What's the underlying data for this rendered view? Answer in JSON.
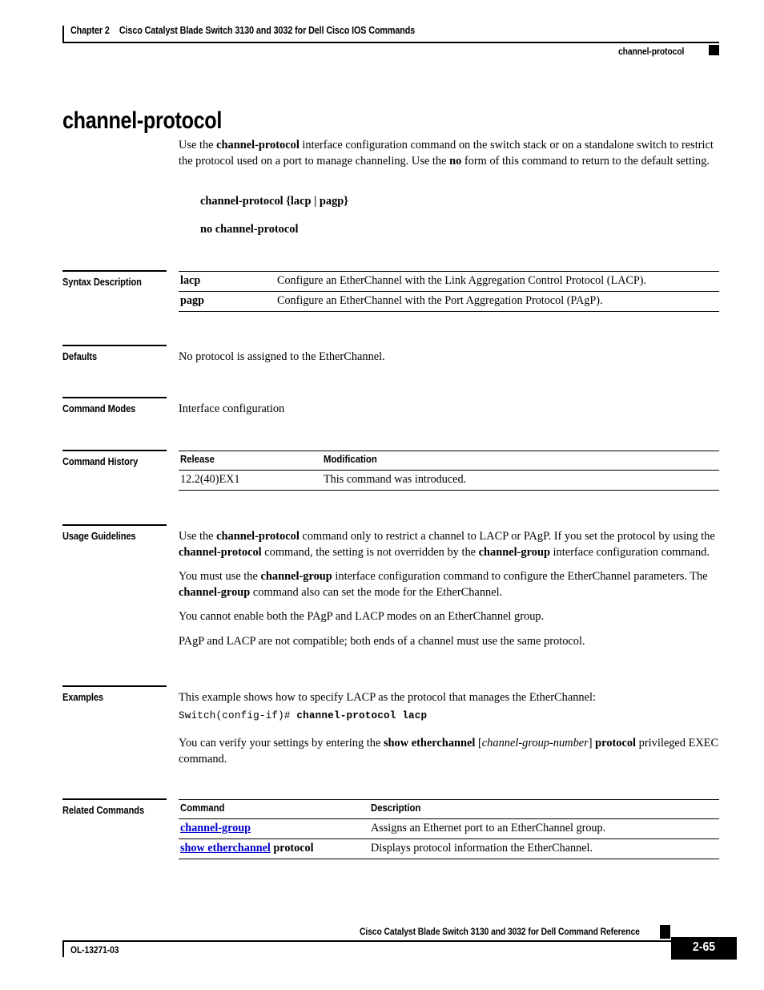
{
  "header": {
    "chapter_number": "Chapter 2",
    "chapter_title": "Cisco Catalyst Blade Switch 3130 and 3032 for Dell Cisco IOS Commands",
    "running_head": "channel-protocol"
  },
  "title": "channel-protocol",
  "intro": {
    "line": "Use the channel-protocol interface configuration command on the switch stack or on a standalone switch to restrict the protocol used on a port to manage channeling. Use the no form of this command to return to the default setting.",
    "part1": "Use the ",
    "bold1": "channel-protocol",
    "part2": " interface configuration command on the switch stack or on a standalone switch to restrict the protocol used on a port to manage channeling. Use the ",
    "bold2": "no",
    "part3": " form of this command to return to the default setting."
  },
  "syntax": {
    "positive": "channel-protocol {lacp | pagp}",
    "negative": "no channel-protocol"
  },
  "sections": {
    "syntax_description": "Syntax Description",
    "defaults": "Defaults",
    "command_modes": "Command Modes",
    "command_history": "Command History",
    "usage_guidelines": "Usage Guidelines",
    "examples": "Examples",
    "related_commands": "Related Commands"
  },
  "syntax_description_table": {
    "rows": [
      {
        "term": "lacp",
        "desc": "Configure an EtherChannel with the Link Aggregation Control Protocol (LACP)."
      },
      {
        "term": "pagp",
        "desc": "Configure an EtherChannel with the Port Aggregation Protocol (PAgP)."
      }
    ]
  },
  "defaults": {
    "text": "No protocol is assigned to the EtherChannel."
  },
  "command_modes": {
    "text": "Interface configuration"
  },
  "command_history_table": {
    "headers": {
      "release": "Release",
      "modification": "Modification"
    },
    "rows": [
      {
        "release": "12.2(40)EX1",
        "modification": "This command was introduced."
      }
    ]
  },
  "usage_guidelines": {
    "p1_part1": "Use the ",
    "p1_bold1": "channel-protocol",
    "p1_part2": " command only to restrict a channel to LACP or PAgP. If you set the protocol by using the ",
    "p1_bold2": "channel-protocol",
    "p1_part3": " command, the setting is not overridden by the ",
    "p1_bold3": "channel-group",
    "p1_part4": " interface configuration command.",
    "p2_part1": "You must use the ",
    "p2_bold1": "channel-group",
    "p2_part2": " interface configuration command to configure the EtherChannel parameters. The ",
    "p2_bold2": "channel-group",
    "p2_part3": " command also can set the mode for the EtherChannel.",
    "p3": "You cannot enable both the PAgP and LACP modes on an EtherChannel group.",
    "p4": "PAgP and LACP are not compatible; both ends of a channel must use the same protocol."
  },
  "examples": {
    "intro": "This example shows how to specify LACP as the protocol that manages the EtherChannel:",
    "code_prompt": "Switch(config-if)# ",
    "code_command": "channel-protocol lacp",
    "verify_part1": "You can verify your settings by entering the ",
    "verify_bold1": "show etherchannel",
    "verify_part2": " [",
    "verify_italic": "channel-group-number",
    "verify_part3": "] ",
    "verify_bold2": "protocol",
    "verify_part4": " privileged EXEC command."
  },
  "related_commands_table": {
    "headers": {
      "command": "Command",
      "description": "Description"
    },
    "rows": [
      {
        "command_link": "channel-group",
        "command_plain": "",
        "description": "Assigns an Ethernet port to an EtherChannel group."
      },
      {
        "command_link": "show etherchannel",
        "command_plain": " protocol",
        "description": "Displays protocol information the EtherChannel."
      }
    ]
  },
  "footer": {
    "doc_title": "Cisco Catalyst Blade Switch 3130 and 3032 for Dell Command Reference",
    "doc_id": "OL-13271-03",
    "page_number": "2-65"
  },
  "colors": {
    "link": "#0000cc",
    "text": "#000000",
    "background": "#ffffff"
  }
}
